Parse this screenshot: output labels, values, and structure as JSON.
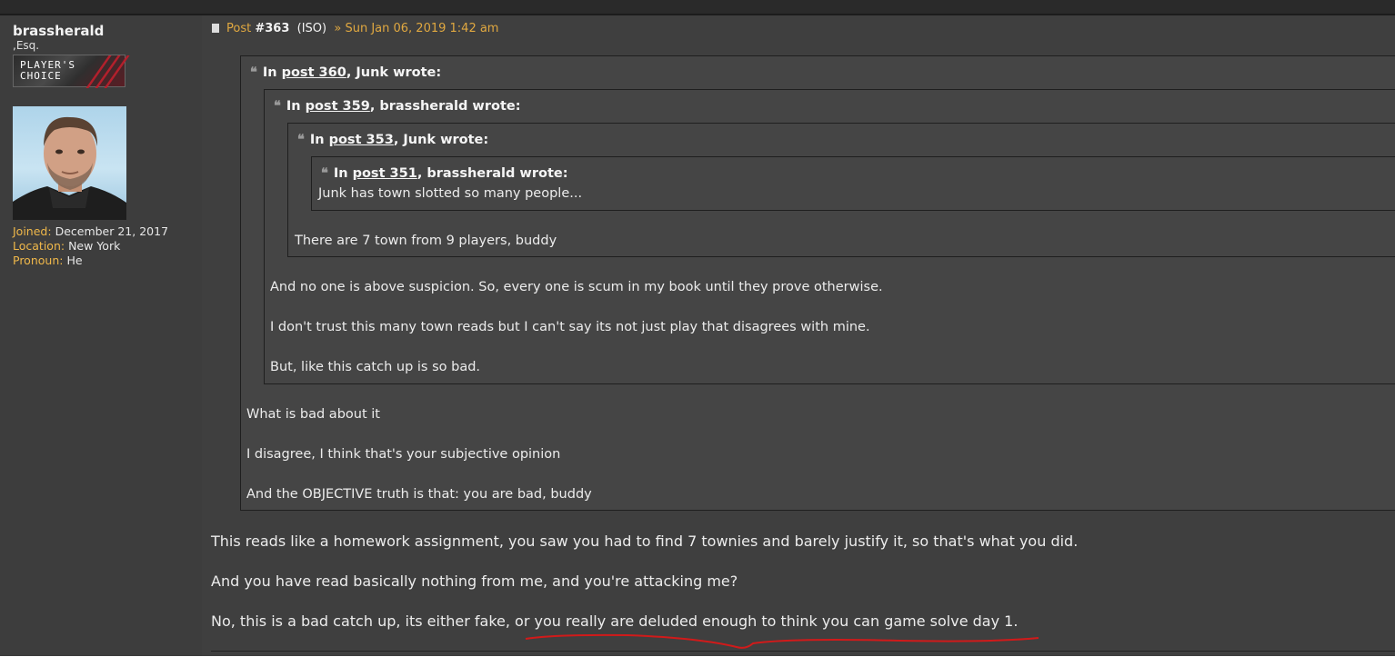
{
  "user": {
    "name": "brassherald",
    "title": ",Esq.",
    "rank_line1": "PLAYER'S",
    "rank_line2": "CHOICE",
    "joined_label": "Joined:",
    "joined_value": "December 21, 2017",
    "location_label": "Location:",
    "location_value": "New York",
    "pronoun_label": "Pronoun:",
    "pronoun_value": "He"
  },
  "post": {
    "label": "Post",
    "number": "#363",
    "iso": "(ISO)",
    "date": "» Sun Jan 06, 2019 1:42 am"
  },
  "quotes": {
    "q1": {
      "prefix": "In",
      "link": "post 360",
      "suffix": ", Junk wrote:",
      "lines": [
        "What is bad about it",
        "I disagree, I think that's your subjective opinion",
        "And the OBJECTIVE truth is that: you are bad, buddy"
      ]
    },
    "q2": {
      "prefix": "In",
      "link": "post 359",
      "suffix": ", brassherald wrote:",
      "lines": [
        "And no one is above suspicion. So, every one is scum in my book until they prove otherwise.",
        "I don't trust this many town reads but I can't say its not just play that disagrees with mine.",
        "But, like this catch up is so bad."
      ]
    },
    "q3": {
      "prefix": "In",
      "link": "post 353",
      "suffix": ", Junk wrote:",
      "lines": [
        "There are 7 town from 9 players, buddy"
      ]
    },
    "q4": {
      "prefix": "In",
      "link": "post 351",
      "suffix": ", brassherald wrote:",
      "lines": [
        "Junk has town slotted so many people..."
      ]
    }
  },
  "body": [
    "This reads like a homework assignment, you saw you had to find 7 townies and barely justify it, so that's what you did.",
    "And you have read basically nothing from me, and you're attacking me?",
    "No, this is a bad catch up, its either fake, or you really are deluded enough to think you can game solve day 1."
  ],
  "colors": {
    "accent": "#e0a840",
    "background": "#3f3f3f",
    "annotation": "#d11a1a"
  },
  "icons": {
    "post": "document-icon",
    "quote": "quote-icon"
  }
}
